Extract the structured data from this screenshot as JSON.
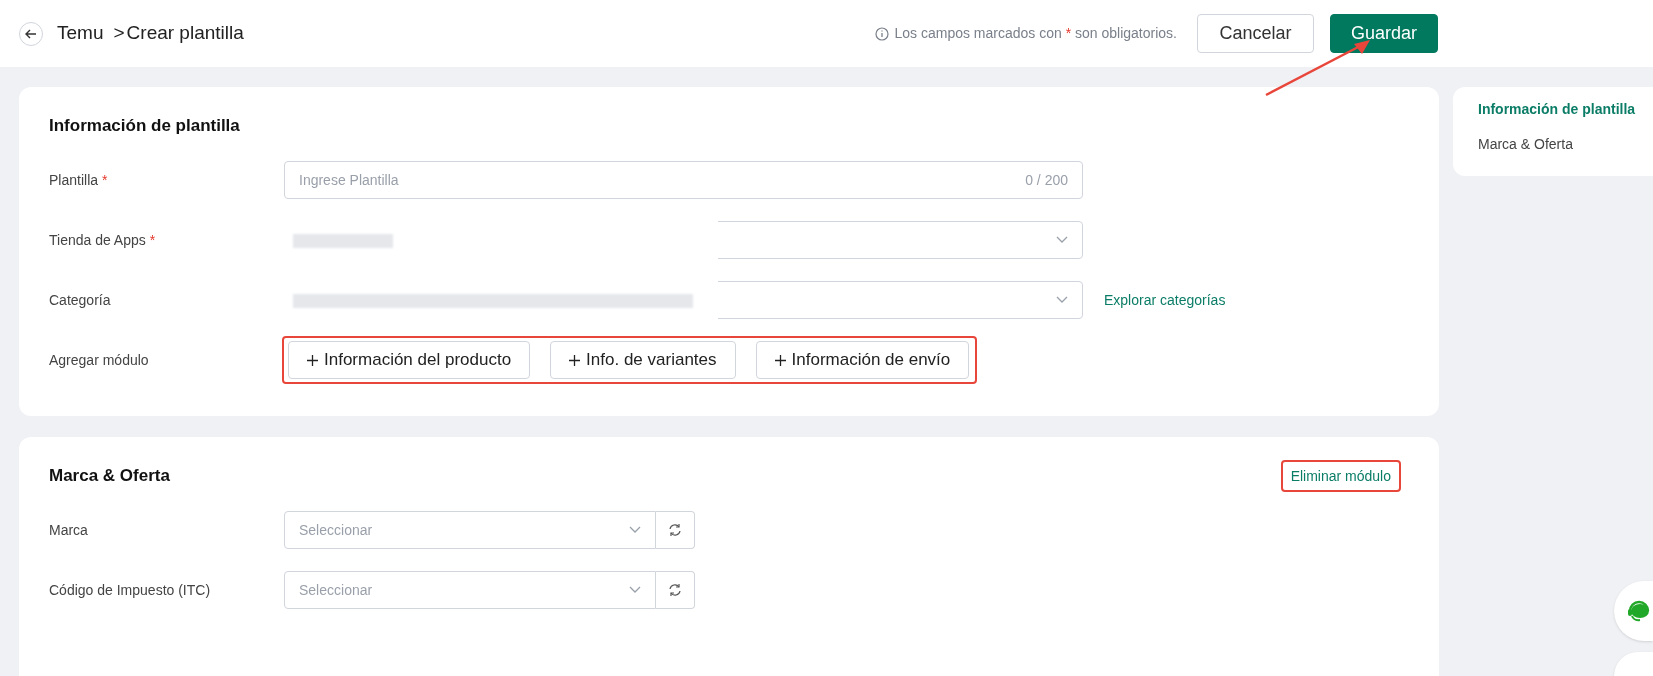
{
  "header": {
    "breadcrumb": [
      {
        "label": "Temu"
      },
      {
        "label": "Crear plantilla",
        "separator": ">"
      }
    ],
    "notice": {
      "before": "Los campos marcados con",
      "mark": "*",
      "after": "son obligatorios."
    },
    "buttons": [
      {
        "label": "Cancelar",
        "kind": "secondary"
      },
      {
        "label": "Guardar",
        "kind": "primary"
      }
    ]
  },
  "sections": [
    {
      "title": "Información de plantilla",
      "fields": [
        {
          "label": "Plantilla",
          "required_mark": "*",
          "kind": "text",
          "placeholder": "Ingrese Plantilla",
          "counter": "0 / 200"
        },
        {
          "label": "Tienda de Apps",
          "required_mark": "*",
          "kind": "redacted-select",
          "redacted_short": true
        },
        {
          "label": "Categoría",
          "kind": "redacted-select",
          "redacted_short": false,
          "link": "Explorar categorías"
        },
        {
          "label": "Agregar módulo",
          "kind": "modules",
          "modules": [
            "Información del producto",
            "Info. de variantes",
            "Información de envío"
          ]
        }
      ]
    },
    {
      "title": "Marca & Oferta",
      "action": "Eliminar módulo",
      "fields": [
        {
          "label": "Marca",
          "kind": "select-refresh",
          "placeholder": "Seleccionar"
        },
        {
          "label": "Código de Impuesto (ITC)",
          "kind": "select-refresh",
          "placeholder": "Seleccionar"
        }
      ]
    }
  ],
  "nav": [
    {
      "label": "Información de plantilla",
      "selected": true
    },
    {
      "label": "Marca & Oferta",
      "selected": false
    }
  ]
}
